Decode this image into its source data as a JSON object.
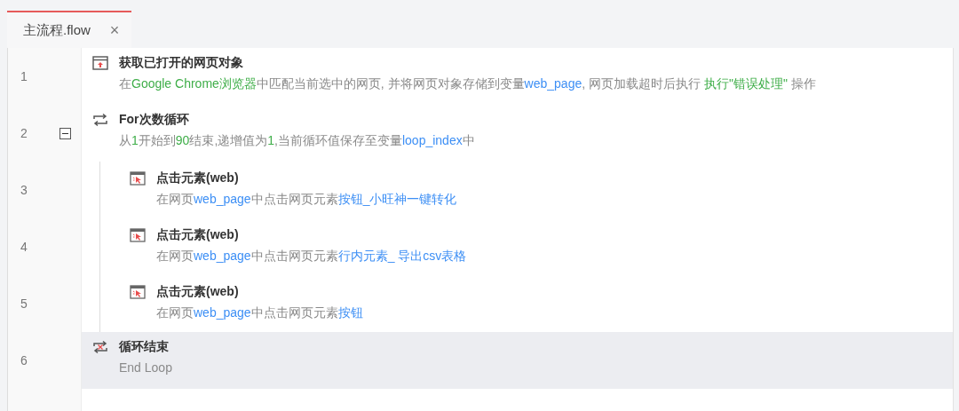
{
  "tabs": [
    {
      "label": "主流程.flow",
      "selected": true,
      "close": "×"
    }
  ],
  "steps": [
    {
      "line": "1",
      "kind": "browser",
      "title": "获取已打开的网页对象",
      "selected": false,
      "description": [
        {
          "text": "在",
          "kind": "text"
        },
        {
          "text": "Google Chrome浏览器",
          "kind": "value"
        },
        {
          "text": "中匹配当前选中的网页, 并将网页对象存储到变量",
          "kind": "text"
        },
        {
          "text": "web_page",
          "kind": "variable"
        },
        {
          "text": ", 网页加载超时后执行 ",
          "kind": "text"
        },
        {
          "text": "执行\"错误处理\"",
          "kind": "value"
        },
        {
          "text": " 操作",
          "kind": "text"
        }
      ]
    },
    {
      "line": "2",
      "kind": "loop",
      "title": "For次数循环",
      "selected": false,
      "expanded": true,
      "description": [
        {
          "text": "从",
          "kind": "text"
        },
        {
          "text": "1",
          "kind": "value"
        },
        {
          "text": "开始到",
          "kind": "text"
        },
        {
          "text": "90",
          "kind": "value"
        },
        {
          "text": "结束,递增值为",
          "kind": "text"
        },
        {
          "text": "1",
          "kind": "value"
        },
        {
          "text": ",当前循环值保存至变量",
          "kind": "text"
        },
        {
          "text": "loop_index",
          "kind": "variable"
        },
        {
          "text": "中",
          "kind": "text"
        }
      ],
      "children": [
        {
          "line": "3",
          "kind": "click",
          "title": "点击元素(web)",
          "selected": false,
          "description": [
            {
              "text": "在网页",
              "kind": "text"
            },
            {
              "text": "web_page",
              "kind": "variable"
            },
            {
              "text": "中点击网页元素",
              "kind": "text"
            },
            {
              "text": "按钮_小旺神一键转化",
              "kind": "variable"
            }
          ]
        },
        {
          "line": "4",
          "kind": "click",
          "title": "点击元素(web)",
          "selected": false,
          "description": [
            {
              "text": "在网页",
              "kind": "text"
            },
            {
              "text": "web_page",
              "kind": "variable"
            },
            {
              "text": "中点击网页元素",
              "kind": "text"
            },
            {
              "text": "行内元素_ 导出csv表格",
              "kind": "variable"
            }
          ]
        },
        {
          "line": "5",
          "kind": "click",
          "title": "点击元素(web)",
          "selected": false,
          "description": [
            {
              "text": "在网页",
              "kind": "text"
            },
            {
              "text": "web_page",
              "kind": "variable"
            },
            {
              "text": "中点击网页元素",
              "kind": "text"
            },
            {
              "text": "按钮",
              "kind": "variable"
            }
          ]
        }
      ]
    },
    {
      "line": "6",
      "kind": "loop-end",
      "title": "循环结束",
      "selected": true,
      "description": [
        {
          "text": "End Loop",
          "kind": "text"
        }
      ]
    }
  ]
}
